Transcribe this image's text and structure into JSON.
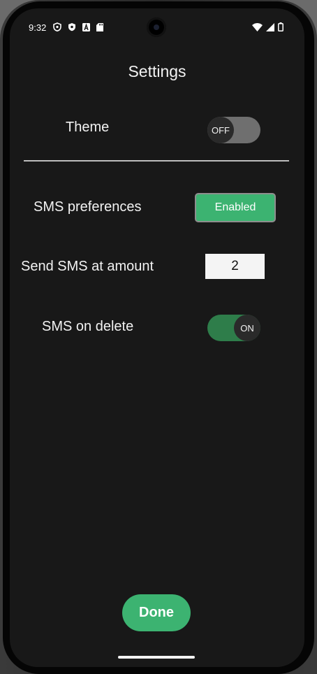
{
  "status_bar": {
    "time": "9:32",
    "left_icons": [
      "shield-icon",
      "shield-filled-icon",
      "a-icon",
      "sd-card-icon"
    ],
    "right_icons": [
      "wifi-icon",
      "signal-icon",
      "battery-icon"
    ]
  },
  "header": {
    "title": "Settings"
  },
  "settings": {
    "theme": {
      "label": "Theme",
      "toggle_text": "OFF",
      "state": "off"
    },
    "sms_preferences": {
      "label": "SMS preferences",
      "button_label": "Enabled"
    },
    "send_sms_amount": {
      "label": "Send SMS at amount",
      "value": "2"
    },
    "sms_on_delete": {
      "label": "SMS on delete",
      "toggle_text": "ON",
      "state": "on"
    }
  },
  "footer": {
    "done_label": "Done"
  },
  "colors": {
    "accent": "#3cb371",
    "toggle_on_track": "#2e7d4a",
    "background": "#181818"
  }
}
